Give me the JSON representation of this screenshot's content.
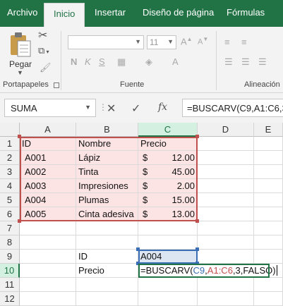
{
  "ribbon": {
    "tabs": [
      "Archivo",
      "Inicio",
      "Insertar",
      "Diseño de página",
      "Fórmulas"
    ],
    "active_tab": "Inicio",
    "paste_label": "Pegar",
    "font_size": "11",
    "groups": [
      "Portapapeles",
      "Fuente",
      "Alineación"
    ]
  },
  "formula_bar": {
    "name_box": "SUMA",
    "cancel_icon": "✕",
    "enter_icon": "✓",
    "fx_label": "fx",
    "formula": "=BUSCARV(C9,A1:C6,3,"
  },
  "grid": {
    "columns": [
      "A",
      "B",
      "C",
      "D",
      "E"
    ],
    "rows": [
      "1",
      "2",
      "3",
      "4",
      "5",
      "6",
      "7",
      "8",
      "9",
      "10",
      "11",
      "12"
    ],
    "currency_symbol": "$",
    "header": {
      "a": "ID",
      "b": "Nombre",
      "c": "Precio"
    },
    "data": [
      {
        "id": "A001",
        "name": "Lápiz",
        "price": "12.00"
      },
      {
        "id": "A002",
        "name": "Tinta",
        "price": "45.00"
      },
      {
        "id": "A003",
        "name": "Impresiones",
        "price": "2.00"
      },
      {
        "id": "A004",
        "name": "Plumas",
        "price": "15.00"
      },
      {
        "id": "A005",
        "name": "Cinta adesiva",
        "price": "13.00"
      }
    ],
    "lookup": {
      "id_label": "ID",
      "id_value": "A004",
      "price_label": "Precio",
      "formula_parts": [
        "=BUSCARV(",
        "C9",
        ",",
        "A1:C6",
        ",3,FALSO)"
      ]
    }
  },
  "colors": {
    "brand": "#217346",
    "range_highlight": "#c0504d",
    "ref_highlight": "#3a6fb5",
    "range_fill": "#fde4e4"
  }
}
